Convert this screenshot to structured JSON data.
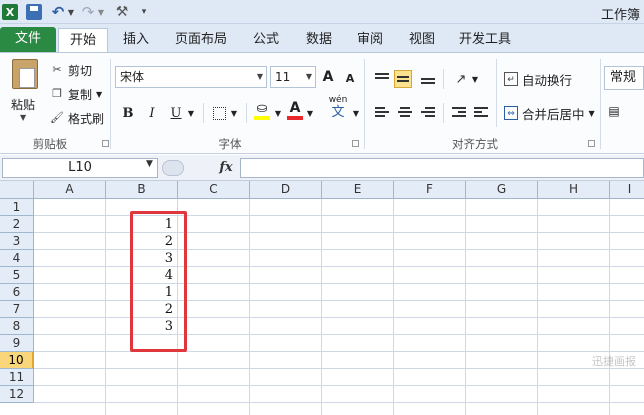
{
  "app": {
    "title": "工作簿"
  },
  "quick_access": {
    "logo": "X"
  },
  "tabs": [
    "文件",
    "开始",
    "插入",
    "页面布局",
    "公式",
    "数据",
    "审阅",
    "视图",
    "开发工具"
  ],
  "clipboard": {
    "paste": "粘贴",
    "cut": "剪切",
    "copy": "复制",
    "format_painter": "格式刷",
    "group": "剪贴板"
  },
  "font": {
    "name": "宋体",
    "size": "11",
    "bold": "B",
    "italic": "I",
    "underline": "U",
    "grow": "A",
    "shrink": "A",
    "font_color": "A",
    "phonetic": "wén",
    "phonetic_char": "文",
    "group": "字体"
  },
  "alignment": {
    "wrap_text": "自动换行",
    "merge_center": "合并后居中",
    "group": "对齐方式"
  },
  "number": {
    "format": "常规"
  },
  "formula_bar": {
    "name_box": "L10",
    "fx": "fx",
    "formula": ""
  },
  "grid": {
    "columns": [
      "A",
      "B",
      "C",
      "D",
      "E",
      "F",
      "G",
      "H",
      "I"
    ],
    "rows": [
      "1",
      "2",
      "3",
      "4",
      "5",
      "6",
      "7",
      "8",
      "9",
      "10",
      "11",
      "12"
    ],
    "active_row": "10",
    "cells_B": [
      "1",
      "2",
      "3",
      "4",
      "1",
      "2",
      "3"
    ]
  },
  "watermark": "迅捷画报"
}
